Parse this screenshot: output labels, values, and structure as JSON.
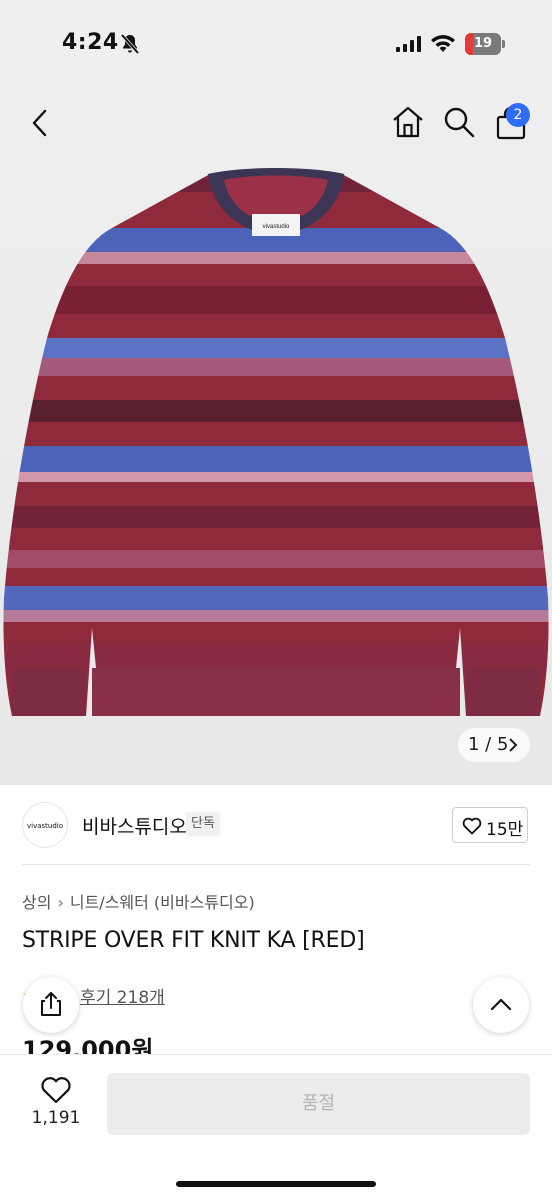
{
  "status_bar": {
    "time": "4:24",
    "battery_level": "19",
    "icons": [
      "bell-slash-icon",
      "signal-icon",
      "wifi-icon",
      "battery-charging-icon"
    ]
  },
  "nav": {
    "icons": [
      "back-icon",
      "home-icon",
      "search-icon",
      "cart-icon"
    ],
    "cart_count": "2"
  },
  "gallery": {
    "image_label": "vivastudio",
    "page_current": "1",
    "page_total": "5",
    "page_text": "1 / 5"
  },
  "brand": {
    "logo_text": "vivastudio",
    "name": "비바스튜디오",
    "tag": "단독",
    "like_count": "15만"
  },
  "product": {
    "breadcrumb": [
      "상의",
      "니트/스웨터 (비바스튜디오)"
    ],
    "title": "STRIPE OVER FIT KNIT KA [RED]",
    "review_text": "후기 218개",
    "price": "129,000원"
  },
  "bottom": {
    "wish_count": "1,191",
    "buy_label": "품절"
  },
  "colors": {
    "accent_blue": "#2f6bff",
    "sweater_red": "#8e2a3c",
    "sweater_blue": "#4b63b8",
    "disabled_bg": "#ececec",
    "disabled_text": "#b5b5b5"
  }
}
